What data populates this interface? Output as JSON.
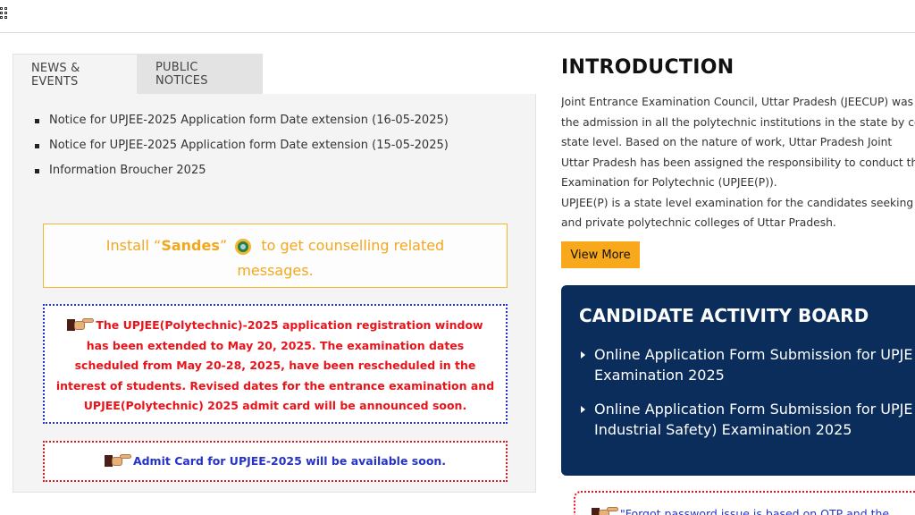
{
  "tabs": [
    {
      "label": "NEWS & EVENTS"
    },
    {
      "label": "PUBLIC NOTICES"
    }
  ],
  "news": [
    "Notice for UPJEE-2025 Application form Date extension (16-05-2025)",
    "Notice for UPJEE-2025 Application form Date extension (15-05-2025)",
    "Information Broucher 2025"
  ],
  "sandes": {
    "prefix": "Install “",
    "app": "Sandes",
    "suffix": "”",
    "line1_end": "to get counselling related",
    "line2": "messages."
  },
  "notice_red": "The UPJEE(Polytechnic)-2025 application registration window has been extended to May 20, 2025. The examination dates scheduled from May 20-28, 2025, have been rescheduled in the interest of students. Revised dates for the entrance examination and UPJEE(Polytechnic) 2025 admit card will be announced soon.",
  "notice_admit": "Admit Card for UPJEE-2025 will be available soon.",
  "intro": {
    "title": "INTRODUCTION",
    "lines": [
      "Joint Entrance Examination Council, Uttar Pradesh (JEECUP) was",
      "the admission in all the polytechnic institutions in the state by co",
      "state level. Based on the nature of work, Uttar Pradesh Joint",
      "Uttar Pradesh has been assigned the responsibility to conduct th",
      "Examination for Polytechnic (UPJEE(P)).",
      "UPJEE(P) is a state level examination for the candidates seeking",
      "and private polytechnic colleges of Uttar Pradesh."
    ],
    "button": "View More"
  },
  "board": {
    "title": "CANDIDATE ACTIVITY BOARD",
    "items": [
      {
        "line1": "Online Application Form Submission for UPJE",
        "line2": "Examination 2025"
      },
      {
        "line1": "Online Application Form Submission for UPJE",
        "line2": "Industrial Safety) Examination 2025"
      }
    ]
  },
  "forgot_notice": "\"Forgot password issue is based on OTP and the"
}
